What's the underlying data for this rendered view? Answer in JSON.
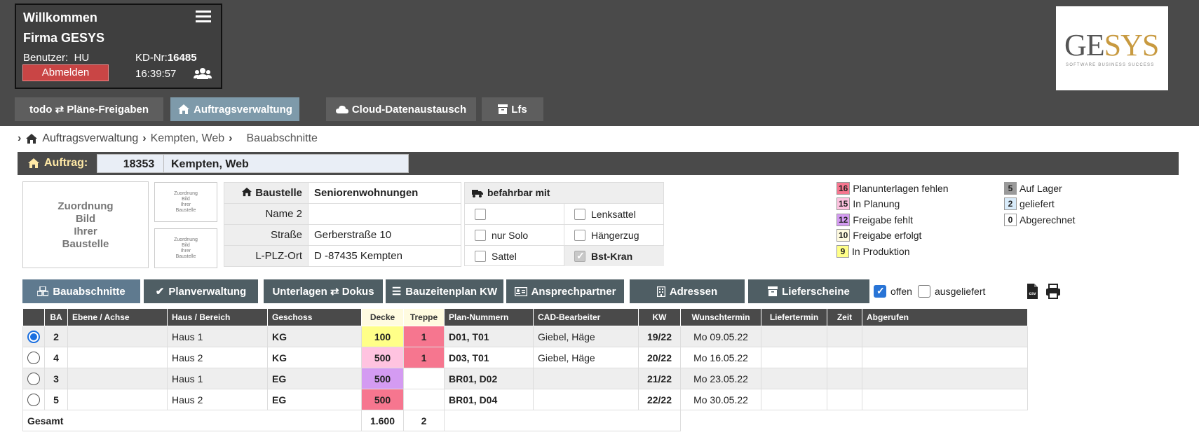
{
  "header": {
    "welcome": "Willkommen",
    "company": "Firma GESYS",
    "user_label": "Benutzer:",
    "user_value": "HU",
    "kd_label": "KD-Nr:",
    "kd_value": "16485",
    "logout": "Abmelden",
    "time": "16:39:57",
    "logo_ge": "GE",
    "logo_sys": "SYS",
    "logo_sub": "SOFTWARE  BUSINESS  SUCCESS"
  },
  "nav": {
    "tabs": [
      {
        "label": "todo ⇄ Pläne-Freigaben"
      },
      {
        "label": "Auftragsverwaltung"
      },
      {
        "label": "Cloud-Datenaustausch"
      },
      {
        "label": "Lfs"
      }
    ]
  },
  "breadcrumb": {
    "b1": "Auftragsverwaltung",
    "b2": "Kempten, Web",
    "b3": "Bauabschnitte"
  },
  "auftrag": {
    "label": "Auftrag:",
    "number": "18353",
    "name": "Kempten, Web"
  },
  "images": {
    "big": [
      "Zuordnung",
      "Bild",
      "Ihrer",
      "Baustelle"
    ],
    "small": [
      "Zuordnung",
      "Bild",
      "Ihrer",
      "Baustelle"
    ]
  },
  "baustelle": {
    "title": "Baustelle",
    "title_value": "Seniorenwohnungen",
    "rows": [
      {
        "key": "Name 2",
        "value": ""
      },
      {
        "key": "Straße",
        "value": "Gerberstraße 10"
      },
      {
        "key": "L-PLZ-Ort",
        "value": "D -87435 Kempten"
      }
    ]
  },
  "befahrbar": {
    "title": "befahrbar mit",
    "options": [
      {
        "label": "",
        "checked": false
      },
      {
        "label": "Lenksattel",
        "checked": false
      },
      {
        "label": "nur Solo",
        "checked": false
      },
      {
        "label": "Hängerzug",
        "checked": false
      },
      {
        "label": "Sattel",
        "checked": false
      },
      {
        "label": "Bst-Kran",
        "checked": true
      }
    ]
  },
  "legend": [
    {
      "count": "16",
      "label": "Planunterlagen fehlen",
      "color": "#f6768f"
    },
    {
      "count": "15",
      "label": "In Planung",
      "color": "#ffc3e0"
    },
    {
      "count": "12",
      "label": "Freigabe fehlt",
      "color": "#d49bf2"
    },
    {
      "count": "10",
      "label": "Freigabe erfolgt",
      "color": "#fffbe0"
    },
    {
      "count": "9",
      "label": "In Produktion",
      "color": "#ffff88"
    },
    {
      "count": "5",
      "label": "Auf Lager",
      "color": "#9a9a9a"
    },
    {
      "count": "2",
      "label": "geliefert",
      "color": "#d9ecfb"
    },
    {
      "count": "0",
      "label": "Abgerechnet",
      "color": "#ffffff"
    }
  ],
  "tabs2": [
    {
      "label": "Bauabschnitte"
    },
    {
      "label": "Planverwaltung"
    },
    {
      "label": "Unterlagen ⇄ Dokus"
    },
    {
      "label": "Bauzeitenplan KW"
    },
    {
      "label": "Ansprechpartner"
    },
    {
      "label": "Adressen"
    },
    {
      "label": "Lieferscheine"
    }
  ],
  "filters": {
    "offen": "offen",
    "offen_checked": true,
    "ausgeliefert": "ausgeliefert",
    "ausgeliefert_checked": false
  },
  "table": {
    "headers": [
      "",
      "BA",
      "Ebene / Achse",
      "Haus / Bereich",
      "Geschoss",
      "Decke",
      "Treppe",
      "Plan-Nummern",
      "CAD-Bearbeiter",
      "KW",
      "Wunschtermin",
      "Liefertermin",
      "Zeit",
      "Abgerufen"
    ],
    "rows": [
      {
        "selected": true,
        "ba": "2",
        "ebene": "",
        "haus": "Haus 1",
        "geschoss": "KG",
        "decke": "100",
        "treppe": "1",
        "plan": "D01, T01",
        "cad": "Giebel, Häge",
        "kw": "19/22",
        "wunsch": "Mo 09.05.22",
        "liefer": "",
        "zeit": "",
        "abgerufen": ""
      },
      {
        "selected": false,
        "ba": "4",
        "ebene": "",
        "haus": "Haus 2",
        "geschoss": "KG",
        "decke": "500",
        "treppe": "1",
        "plan": "D03, T01",
        "cad": "Giebel, Häge",
        "kw": "20/22",
        "wunsch": "Mo 16.05.22",
        "liefer": "",
        "zeit": "",
        "abgerufen": ""
      },
      {
        "selected": false,
        "ba": "3",
        "ebene": "",
        "haus": "Haus 1",
        "geschoss": "EG",
        "decke": "500",
        "treppe": "",
        "plan": "BR01, D02",
        "cad": "",
        "kw": "21/22",
        "wunsch": "Mo 23.05.22",
        "liefer": "",
        "zeit": "",
        "abgerufen": ""
      },
      {
        "selected": false,
        "ba": "5",
        "ebene": "",
        "haus": "Haus 2",
        "geschoss": "EG",
        "decke": "500",
        "treppe": "",
        "plan": "BR01, D04",
        "cad": "",
        "kw": "22/22",
        "wunsch": "Mo 30.05.22",
        "liefer": "",
        "zeit": "",
        "abgerufen": ""
      }
    ],
    "total_label": "Gesamt",
    "total_decke": "1.600",
    "total_treppe": "2"
  }
}
